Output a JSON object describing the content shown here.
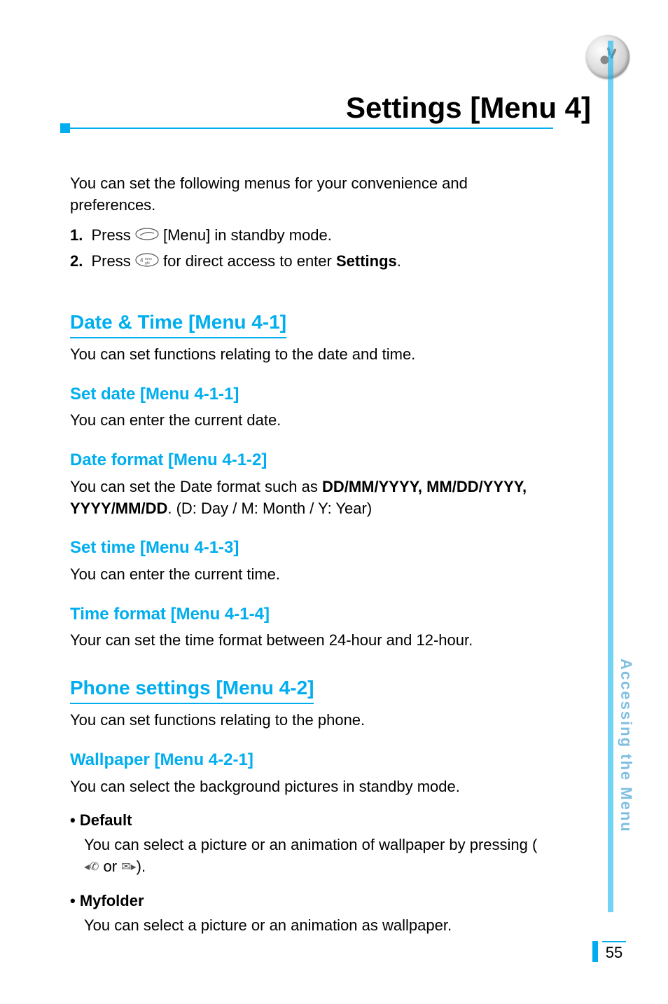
{
  "page": {
    "title": "Settings [Menu 4]",
    "side_label": "Accessing the Menu",
    "page_number": "55"
  },
  "intro": "You can set the following menus for your convenience and preferences.",
  "steps": [
    {
      "num": "1.",
      "pre": "Press ",
      "post": " [Menu] in standby mode."
    },
    {
      "num": "2.",
      "pre": "Press ",
      "post": " for direct access to enter ",
      "bold_tail": "Settings",
      "end": "."
    }
  ],
  "sections": {
    "date_time": {
      "heading": "Date & Time [Menu 4-1]",
      "desc": "You can set functions relating to the date and time.",
      "items": [
        {
          "h": "Set date [Menu 4-1-1]",
          "body": "You can enter the current date."
        },
        {
          "h": "Date format [Menu 4-1-2]",
          "body_pre": "You can set the Date format such as ",
          "body_bold": "DD/MM/YYYY, MM/DD/YYYY, YYYY/MM/DD",
          "body_post": ". (D: Day / M: Month / Y: Year)"
        },
        {
          "h": "Set time [Menu 4-1-3]",
          "body": "You can enter the current time."
        },
        {
          "h": "Time format [Menu 4-1-4]",
          "body": "Your can set the time format between 24-hour and 12-hour."
        }
      ]
    },
    "phone": {
      "heading": "Phone settings [Menu 4-2]",
      "desc": "You can set functions relating to the phone.",
      "wallpaper": {
        "h": "Wallpaper [Menu 4-2-1]",
        "desc": "You can select the background pictures in standby mode.",
        "bullets": [
          {
            "label": "Default",
            "body_pre": "You can select a picture or an animation of wallpaper by pressing (",
            "body_mid": " or ",
            "body_post": ")."
          },
          {
            "label": "Myfolder",
            "body": "You can select a picture or an animation as wallpaper."
          }
        ]
      }
    }
  }
}
